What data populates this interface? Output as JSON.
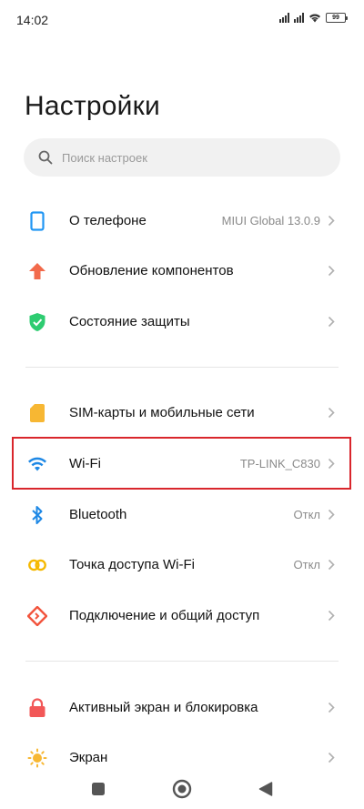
{
  "status_bar": {
    "time": "14:02",
    "battery": "99",
    "icons": [
      "signal-icon",
      "signal-icon",
      "wifi-icon",
      "battery-icon"
    ]
  },
  "page": {
    "title": "Настройки"
  },
  "search": {
    "placeholder": "Поиск настроек",
    "icon": "search-icon"
  },
  "groups": {
    "device": [
      {
        "label": "О телефоне",
        "value": "MIUI Global 13.0.9",
        "icon": "phone-icon",
        "color": "#2196f3"
      },
      {
        "label": "Обновление компонентов",
        "value": "",
        "icon": "arrow-up-icon",
        "color": "#f26a4b"
      },
      {
        "label": "Состояние защиты",
        "value": "",
        "icon": "shield-check-icon",
        "color": "#2ecc71"
      }
    ],
    "network": [
      {
        "label": "SIM-карты и мобильные сети",
        "value": "",
        "icon": "sim-card-icon",
        "color": "#f7b733"
      },
      {
        "label": "Wi-Fi",
        "value": "TP-LINK_C830",
        "icon": "wifi-icon",
        "color": "#1e88e5",
        "highlighted": true
      },
      {
        "label": "Bluetooth",
        "value": "Откл",
        "icon": "bluetooth-icon",
        "color": "#1e88e5"
      },
      {
        "label": "Точка доступа Wi-Fi",
        "value": "Откл",
        "icon": "hotspot-icon",
        "color": "#f5b800"
      },
      {
        "label": "Подключение и общий доступ",
        "value": "",
        "icon": "share-icon",
        "color": "#f2543d"
      }
    ],
    "display": [
      {
        "label": "Активный экран и блокировка",
        "value": "",
        "icon": "lock-icon",
        "color": "#f25757"
      },
      {
        "label": "Экран",
        "value": "",
        "icon": "sun-icon",
        "color": "#f7b733"
      }
    ]
  },
  "highlight_color": "#d9262c",
  "nav_bar": {
    "buttons": [
      "recents-icon",
      "home-icon",
      "back-icon"
    ]
  }
}
